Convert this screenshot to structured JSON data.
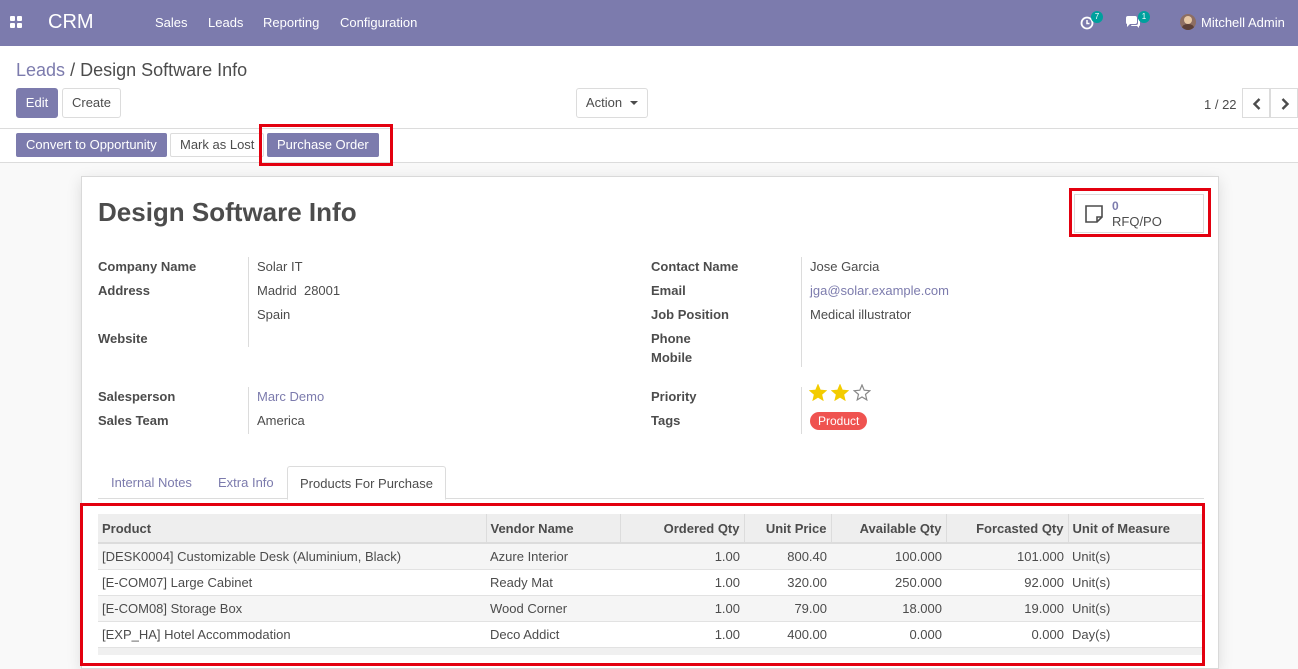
{
  "navbar": {
    "brand": "CRM",
    "menu": [
      "Sales",
      "Leads",
      "Reporting",
      "Configuration"
    ],
    "activity_count": "7",
    "message_count": "1",
    "user_name": "Mitchell Admin"
  },
  "breadcrumb": {
    "parent": "Leads",
    "separator": "/",
    "current": "Design Software Info"
  },
  "control_panel": {
    "edit_label": "Edit",
    "create_label": "Create",
    "action_label": "Action",
    "pager": "1 / 22"
  },
  "statusbar": {
    "convert_label": "Convert to Opportunity",
    "mark_lost_label": "Mark as Lost",
    "purchase_order_label": "Purchase Order"
  },
  "record": {
    "title": "Design Software Info",
    "smart_button": {
      "count": "0",
      "label": "RFQ/PO"
    },
    "left_fields": {
      "company_name_label": "Company Name",
      "company_name": "Solar IT",
      "address_label": "Address",
      "address_city_zip": "Madrid  28001",
      "address_country": "Spain",
      "website_label": "Website",
      "salesperson_label": "Salesperson",
      "salesperson": "Marc Demo",
      "sales_team_label": "Sales Team",
      "sales_team": "America"
    },
    "right_fields": {
      "contact_name_label": "Contact Name",
      "contact_name": "Jose Garcia",
      "email_label": "Email",
      "email": "jga@solar.example.com",
      "job_position_label": "Job Position",
      "job_position": "Medical illustrator",
      "phone_label": "Phone",
      "mobile_label": "Mobile",
      "priority_label": "Priority",
      "priority_stars": 2,
      "priority_max": 3,
      "tags_label": "Tags",
      "tag": "Product"
    },
    "tabs": [
      "Internal Notes",
      "Extra Info",
      "Products For Purchase"
    ],
    "active_tab": "Products For Purchase"
  },
  "products_table": {
    "columns": [
      "Product",
      "Vendor Name",
      "Ordered Qty",
      "Unit Price",
      "Available Qty",
      "Forcasted Qty",
      "Unit of Measure"
    ],
    "rows": [
      [
        "[DESK0004] Customizable Desk (Aluminium, Black)",
        "Azure Interior",
        "1.00",
        "800.40",
        "100.000",
        "101.000",
        "Unit(s)"
      ],
      [
        "[E-COM07] Large Cabinet",
        "Ready Mat",
        "1.00",
        "320.00",
        "250.000",
        "92.000",
        "Unit(s)"
      ],
      [
        "[E-COM08] Storage Box",
        "Wood Corner",
        "1.00",
        "79.00",
        "18.000",
        "19.000",
        "Unit(s)"
      ],
      [
        "[EXP_HA] Hotel Accommodation",
        "Deco Addict",
        "1.00",
        "400.00",
        "0.000",
        "0.000",
        "Day(s)"
      ]
    ]
  },
  "colors": {
    "brand": "#7c7bad",
    "highlight": "#e3000f",
    "tag": "#ef5350",
    "star": "#f3cc00",
    "badge": "#00a09d"
  },
  "icons": [
    "apps-grid-icon",
    "activity-clock-icon",
    "chat-bubbles-icon",
    "chevron-left-icon",
    "chevron-right-icon",
    "document-icon",
    "star-icon"
  ]
}
